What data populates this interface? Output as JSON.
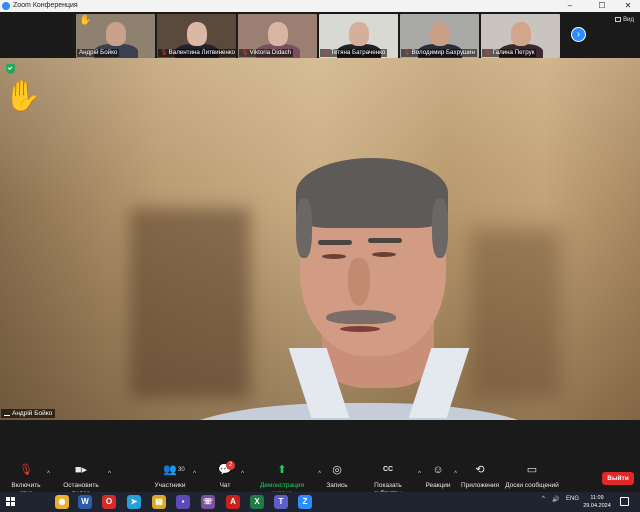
{
  "window": {
    "title": "Zoom Конференция",
    "controls": {
      "minimize": "–",
      "maximize": "☐",
      "close": "✕"
    }
  },
  "gallery": {
    "view_label": "Вид",
    "tiles": [
      {
        "name": "Андрій Бойко",
        "muted": false,
        "hand_raised": true,
        "bg": "#8e8170",
        "face": "#c9a08a",
        "body": "#3a4050"
      },
      {
        "name": "Валентина Литвиненко",
        "muted": true,
        "hand_raised": false,
        "bg": "#5a4a3e",
        "face": "#dcb7a3",
        "body": "#22222a"
      },
      {
        "name": "Viktoria Didach",
        "muted": true,
        "hand_raised": false,
        "bg": "#9a7f72",
        "face": "#d8b4a4",
        "body": "#7a5060"
      },
      {
        "name": "Тетяна Батраченко",
        "muted": true,
        "hand_raised": false,
        "bg": "#d9d9d4",
        "face": "#d4b09a",
        "body": "#222226"
      },
      {
        "name": "Володимир Бахрушин",
        "muted": true,
        "hand_raised": false,
        "bg": "#a9aaa6",
        "face": "#c89e86",
        "body": "#2a2e38"
      },
      {
        "name": "Галина Петрук",
        "muted": true,
        "hand_raised": false,
        "bg": "#c9c4be",
        "face": "#d2a58d",
        "body": "#3a2a30"
      }
    ],
    "next_icon": "chevron-right-icon"
  },
  "main": {
    "speaker_name": "Андрій Бойко",
    "hand_raised_icon": "raised-hand-icon",
    "security_icon": "shield-icon"
  },
  "toolbar": {
    "mute": {
      "label": "Включить звук",
      "icon": "mic-muted-icon"
    },
    "video": {
      "label": "Остановить видео",
      "icon": "camera-icon"
    },
    "participants": {
      "label": "Участники",
      "count": "30",
      "icon": "people-icon"
    },
    "chat": {
      "label": "Чат",
      "badge": "2",
      "icon": "chat-icon"
    },
    "share": {
      "label": "Демонстрация экрана",
      "icon": "share-screen-icon",
      "color": "#23d160"
    },
    "record": {
      "label": "Запись",
      "icon": "record-icon"
    },
    "captions": {
      "label": "Показать субтитры",
      "icon": "cc-icon"
    },
    "reactions": {
      "label": "Реакции",
      "icon": "smile-icon"
    },
    "apps": {
      "label": "Приложения",
      "icon": "apps-icon"
    },
    "whiteboards": {
      "label": "Доски сообщений",
      "icon": "whiteboard-icon"
    },
    "leave": {
      "label": "Выйти",
      "color": "#e02828"
    }
  },
  "taskbar": {
    "apps": [
      {
        "name": "chrome-icon",
        "glyph": "◉",
        "color": "#e8b130"
      },
      {
        "name": "word-icon",
        "glyph": "W",
        "color": "#2b5caa"
      },
      {
        "name": "opera-icon",
        "glyph": "O",
        "color": "#d52b2b"
      },
      {
        "name": "telegram-icon",
        "glyph": "➤",
        "color": "#2aa0da"
      },
      {
        "name": "explorer-icon",
        "glyph": "▤",
        "color": "#d9a928"
      },
      {
        "name": "save-icon",
        "glyph": "▪",
        "color": "#5c4ab8"
      },
      {
        "name": "viber-icon",
        "glyph": "☏",
        "color": "#7b519d"
      },
      {
        "name": "pdf-icon",
        "glyph": "A",
        "color": "#c8221f"
      },
      {
        "name": "excel-icon",
        "glyph": "X",
        "color": "#1f7a44"
      },
      {
        "name": "teams-icon",
        "glyph": "T",
        "color": "#5b5fc7"
      },
      {
        "name": "zoom-icon",
        "glyph": "Z",
        "color": "#2d8cff"
      }
    ],
    "language": "ENG",
    "time": "11:09",
    "date": "29.04.2024"
  }
}
